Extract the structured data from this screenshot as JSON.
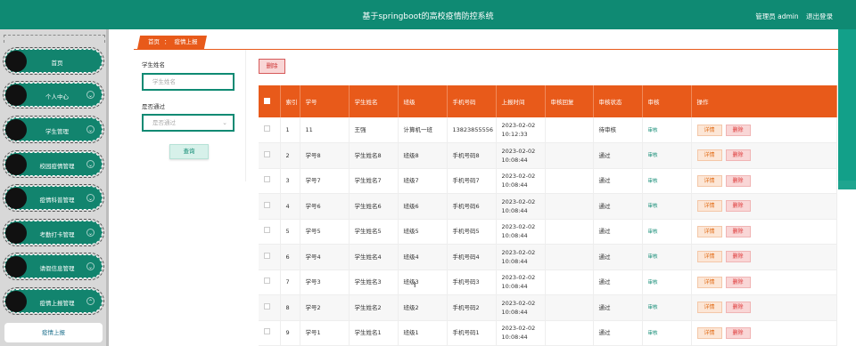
{
  "app": {
    "title": "基于springboot的高校疫情防控系统",
    "role_label": "管理员 admin",
    "logout_label": "退出登录"
  },
  "sidebar": {
    "items": [
      {
        "label": "首页",
        "has_chevron": false
      },
      {
        "label": "个人中心",
        "has_chevron": true
      },
      {
        "label": "学生管理",
        "has_chevron": true
      },
      {
        "label": "校园疫情管理",
        "has_chevron": true
      },
      {
        "label": "疫情科普管理",
        "has_chevron": true
      },
      {
        "label": "考勤打卡管理",
        "has_chevron": true
      },
      {
        "label": "请假信息管理",
        "has_chevron": true
      },
      {
        "label": "疫情上报管理",
        "has_chevron": true,
        "expanded": true
      }
    ],
    "submenu": {
      "label": "疫情上报"
    }
  },
  "breadcrumb": {
    "home": "首页",
    "separator": "：",
    "current": "疫情上报"
  },
  "filter": {
    "name_label": "学生姓名",
    "name_placeholder": "学生姓名",
    "passed_label": "是否通过",
    "passed_placeholder": "是否通过",
    "query_button": "查询"
  },
  "toolbar": {
    "delete_label": "删除"
  },
  "table": {
    "columns": [
      "索引",
      "学号",
      "学生姓名",
      "班级",
      "手机号码",
      "上报时间",
      "审核回复",
      "审核状态",
      "审核",
      "操作"
    ],
    "rows": [
      {
        "index": "1",
        "student_no": "11",
        "name": "王强",
        "class": "计算机一班",
        "phone": "13823855556",
        "date": "2023-02-02",
        "time": "10:12:33",
        "reply": "",
        "status": "待审核"
      },
      {
        "index": "2",
        "student_no": "学号8",
        "name": "学生姓名8",
        "class": "班级8",
        "phone": "手机号码8",
        "date": "2023-02-02",
        "time": "10:08:44",
        "reply": "",
        "status": "通过"
      },
      {
        "index": "3",
        "student_no": "学号7",
        "name": "学生姓名7",
        "class": "班级7",
        "phone": "手机号码7",
        "date": "2023-02-02",
        "time": "10:08:44",
        "reply": "",
        "status": "通过"
      },
      {
        "index": "4",
        "student_no": "学号6",
        "name": "学生姓名6",
        "class": "班级6",
        "phone": "手机号码6",
        "date": "2023-02-02",
        "time": "10:08:44",
        "reply": "",
        "status": "通过"
      },
      {
        "index": "5",
        "student_no": "学号5",
        "name": "学生姓名5",
        "class": "班级5",
        "phone": "手机号码5",
        "date": "2023-02-02",
        "time": "10:08:44",
        "reply": "",
        "status": "通过"
      },
      {
        "index": "6",
        "student_no": "学号4",
        "name": "学生姓名4",
        "class": "班级4",
        "phone": "手机号码4",
        "date": "2023-02-02",
        "time": "10:08:44",
        "reply": "",
        "status": "通过"
      },
      {
        "index": "7",
        "student_no": "学号3",
        "name": "学生姓名3",
        "class": "班级3",
        "phone": "手机号码3",
        "date": "2023-02-02",
        "time": "10:08:44",
        "reply": "",
        "status": "通过"
      },
      {
        "index": "8",
        "student_no": "学号2",
        "name": "学生姓名2",
        "class": "班级2",
        "phone": "手机号码2",
        "date": "2023-02-02",
        "time": "10:08:44",
        "reply": "",
        "status": "通过"
      },
      {
        "index": "9",
        "student_no": "学号1",
        "name": "学生姓名1",
        "class": "班级1",
        "phone": "手机号码1",
        "date": "2023-02-02",
        "time": "10:08:44",
        "reply": "",
        "status": "通过"
      }
    ],
    "audit_label": "审核",
    "detail_label": "详情",
    "delete_label": "删除"
  },
  "colors": {
    "primary": "#0f8a73",
    "accent": "#e85a1a",
    "danger": "#d33333"
  }
}
